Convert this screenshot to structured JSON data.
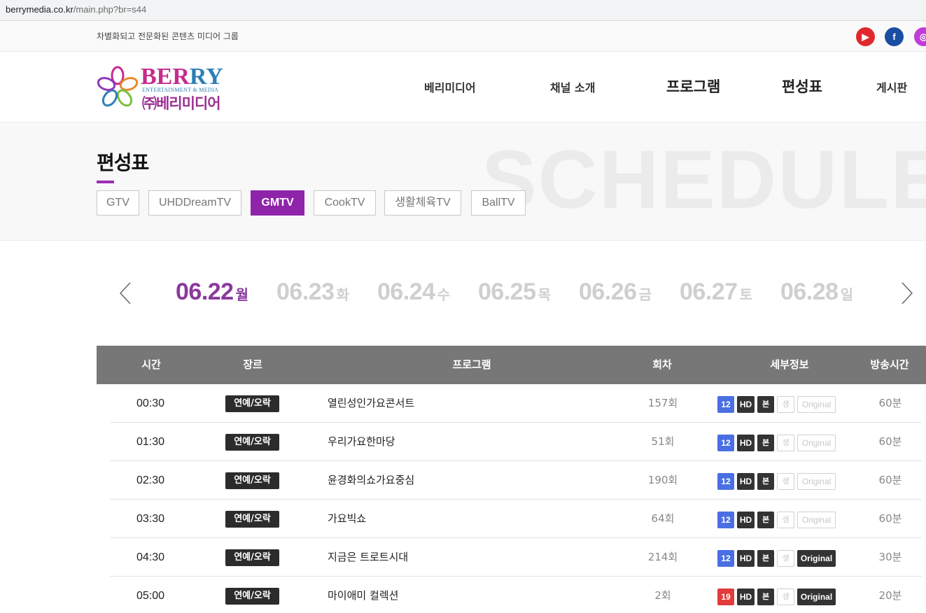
{
  "browser": {
    "url_host": "berrymedia.co.kr",
    "url_path": "/main.php?br=s44"
  },
  "topbar": {
    "tagline": "차별화되고 전문화된 콘텐츠 미디어 그룹",
    "social": [
      {
        "name": "youtube-icon",
        "glyph": "▶",
        "color": "#e0282c"
      },
      {
        "name": "facebook-icon",
        "glyph": "f",
        "color": "#1b4ea3"
      },
      {
        "name": "instagram-icon",
        "glyph": "◎",
        "color": "#c13bd9"
      }
    ]
  },
  "logo": {
    "en_part1": "BER",
    "en_part2": "RY",
    "sub": "ENTERTAINMENT & MEDIA",
    "kr": "㈜베리미디어"
  },
  "nav": {
    "items": [
      "베리미디어",
      "채널 소개",
      "프로그램",
      "편성표",
      "게시판"
    ]
  },
  "section": {
    "watermark": "SCHEDULE",
    "title": "편성표",
    "accent_color": "#9b2fb5"
  },
  "channels": {
    "tabs": [
      "GTV",
      "UHDDreamTV",
      "GMTV",
      "CookTV",
      "생활체육TV",
      "BallTV"
    ],
    "active": "GMTV"
  },
  "dates": [
    {
      "date": "06.22",
      "dow": "월",
      "active": true
    },
    {
      "date": "06.23",
      "dow": "화",
      "active": false
    },
    {
      "date": "06.24",
      "dow": "수",
      "active": false
    },
    {
      "date": "06.25",
      "dow": "목",
      "active": false
    },
    {
      "date": "06.26",
      "dow": "금",
      "active": false
    },
    {
      "date": "06.27",
      "dow": "토",
      "active": false
    },
    {
      "date": "06.28",
      "dow": "일",
      "active": false
    }
  ],
  "table": {
    "headers": [
      "시간",
      "장르",
      "프로그램",
      "회차",
      "세부정보",
      "방송시간"
    ],
    "badge_labels": {
      "hd": "HD",
      "bon": "본",
      "live": "생",
      "original": "Original"
    },
    "colors": {
      "age12": "#4a6fe3",
      "age19": "#e23b3b"
    },
    "rows": [
      {
        "time": "00:30",
        "genre": "연예/오락",
        "program": "열린성인가요콘서트",
        "episode": "157회",
        "age": "12",
        "original": false,
        "duration": "60분"
      },
      {
        "time": "01:30",
        "genre": "연예/오락",
        "program": "우리가요한마당",
        "episode": "51회",
        "age": "12",
        "original": false,
        "duration": "60분"
      },
      {
        "time": "02:30",
        "genre": "연예/오락",
        "program": "윤경화의쇼가요중심",
        "episode": "190회",
        "age": "12",
        "original": false,
        "duration": "60분"
      },
      {
        "time": "03:30",
        "genre": "연예/오락",
        "program": "가요빅쇼",
        "episode": "64회",
        "age": "12",
        "original": false,
        "duration": "60분"
      },
      {
        "time": "04:30",
        "genre": "연예/오락",
        "program": "지금은 트로트시대",
        "episode": "214회",
        "age": "12",
        "original": true,
        "duration": "30분"
      },
      {
        "time": "05:00",
        "genre": "연예/오락",
        "program": "마이애미 컬렉션",
        "episode": "2회",
        "age": "19",
        "original": true,
        "duration": "20분"
      }
    ]
  }
}
